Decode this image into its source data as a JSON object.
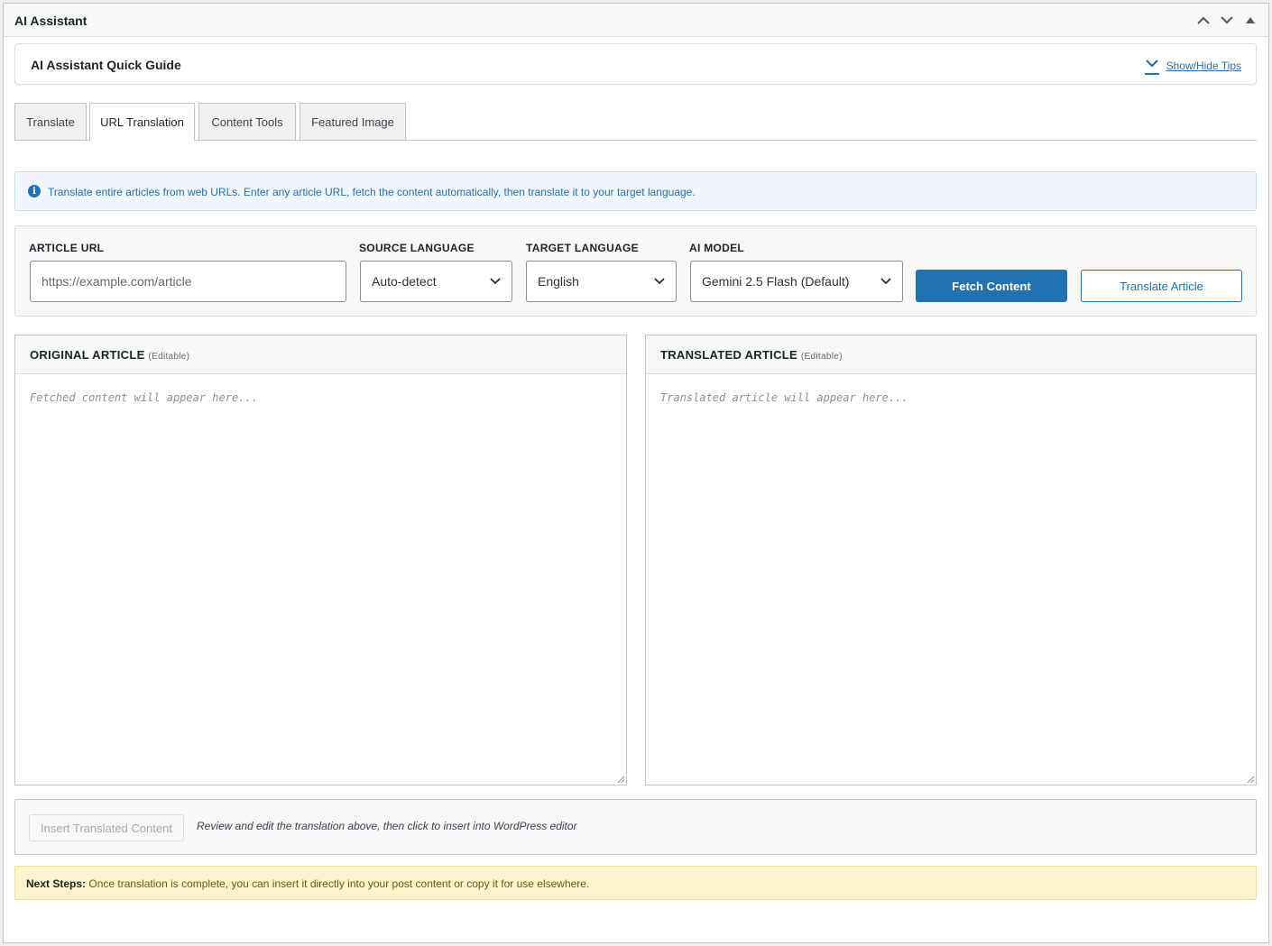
{
  "metabox": {
    "title": "AI Assistant",
    "controls": [
      "chevron-up-icon",
      "chevron-down-icon",
      "triangle-up-icon"
    ]
  },
  "guide": {
    "title": "AI Assistant Quick Guide",
    "toggle_label": "Show/Hide Tips"
  },
  "tabs": [
    {
      "label": "Translate",
      "active": false
    },
    {
      "label": "URL Translation",
      "active": true
    },
    {
      "label": "Content Tools",
      "active": false
    },
    {
      "label": "Featured Image",
      "active": false
    }
  ],
  "info": {
    "icon": "info-icon",
    "icon_glyph": "i",
    "text": "Translate entire articles from web URLs. Enter any article URL, fetch the content automatically, then translate it to your target language."
  },
  "form": {
    "url_label": "ARTICLE URL",
    "url_placeholder": "https://example.com/article",
    "url_value": "",
    "source_label": "SOURCE LANGUAGE",
    "source_value": "Auto-detect",
    "target_label": "TARGET LANGUAGE",
    "target_value": "English",
    "model_label": "AI MODEL",
    "model_value": "Gemini 2.5 Flash (Default)",
    "fetch_label": "Fetch Content",
    "translate_label": "Translate Article"
  },
  "original": {
    "title": "ORIGINAL ARTICLE",
    "sub": "(Editable)",
    "placeholder": "Fetched content will appear here..."
  },
  "translated": {
    "title": "TRANSLATED ARTICLE",
    "sub": "(Editable)",
    "placeholder": "Translated article will appear here..."
  },
  "insert": {
    "button_label": "Insert Translated Content",
    "hint": "Review and edit the translation above, then click to insert into WordPress editor"
  },
  "next_steps": {
    "label": "Next Steps:",
    "text": " Once translation is complete, you can insert it directly into your post content or copy it for use elsewhere."
  },
  "colors": {
    "primary": "#2271b1",
    "notice_bg": "#fcf2cb",
    "info_bg": "#f0f6fc"
  }
}
